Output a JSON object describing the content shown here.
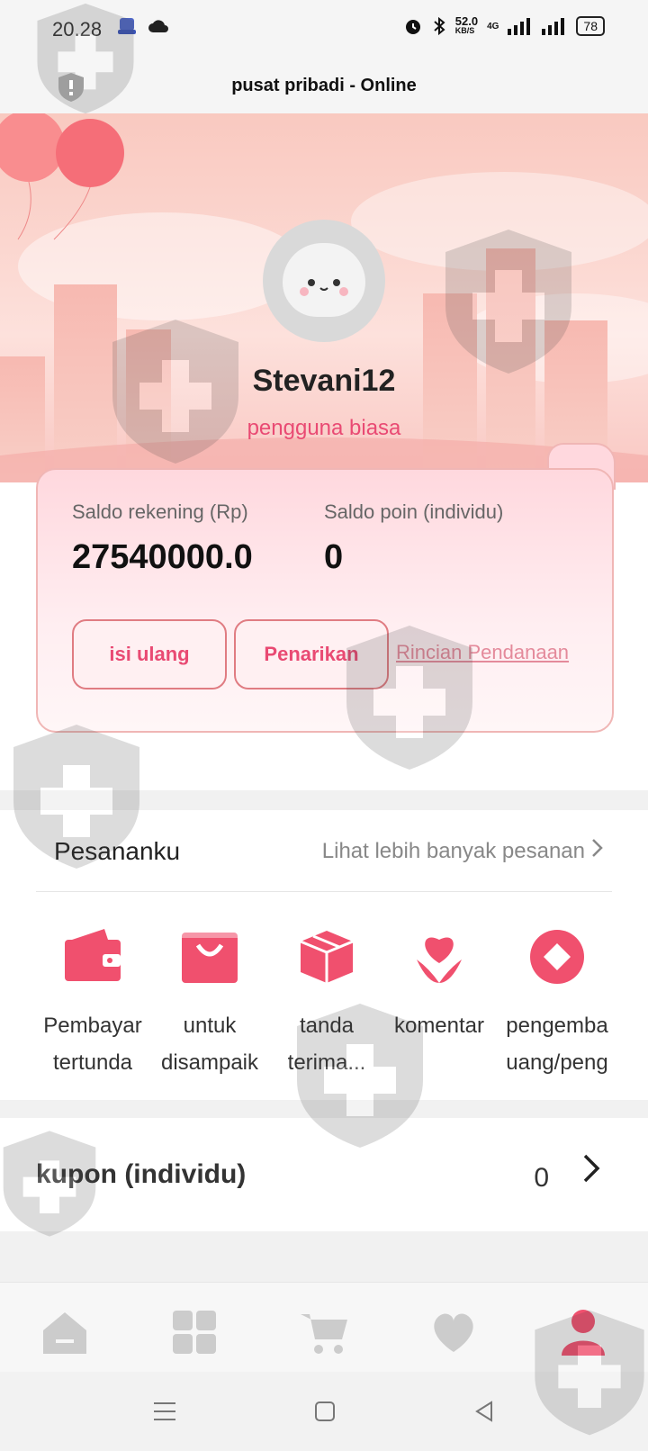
{
  "status_bar": {
    "time": "20.28",
    "net_speed": "52.0",
    "net_unit": "KB/S",
    "network": "4G",
    "battery": "78"
  },
  "header": {
    "title": "pusat pribadi - Online"
  },
  "profile": {
    "username": "Stevani12",
    "level": "pengguna biasa"
  },
  "wallet": {
    "balance_label": "Saldo rekening (Rp)",
    "balance_value": "27540000.0",
    "points_label": "Saldo poin (individu)",
    "points_value": "0",
    "topup_label": "isi ulang",
    "withdraw_label": "Penarikan",
    "details_link": "Rincian Pendanaan"
  },
  "orders": {
    "title": "Pesananku",
    "more": "Lihat lebih banyak pesanan",
    "items": [
      {
        "line1": "Pembayar",
        "line2": "tertunda",
        "icon": "wallet-icon"
      },
      {
        "line1": "untuk",
        "line2": "disampaik",
        "icon": "shopping-bag-icon"
      },
      {
        "line1": "tanda",
        "line2": "terima...",
        "icon": "package-icon"
      },
      {
        "line1": "komentar",
        "line2": "",
        "icon": "flower-icon"
      },
      {
        "line1": "pengemba",
        "line2": "uang/peng",
        "icon": "refund-icon"
      }
    ]
  },
  "coupon": {
    "label": "kupon (individu)",
    "value": "0"
  },
  "tabbar": {
    "items": [
      "home-icon",
      "grid-icon",
      "cart-icon",
      "heart-icon",
      "person-icon"
    ],
    "active": "person-icon",
    "active_color": "#f0506e",
    "inactive_color": "#cccccc"
  },
  "colors": {
    "accent": "#e94a73",
    "icon_red": "#f0506e"
  }
}
